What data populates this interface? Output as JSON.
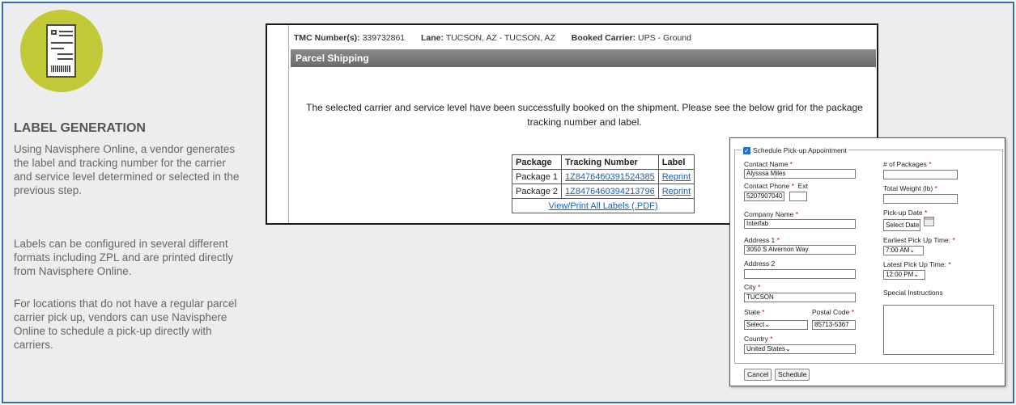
{
  "left_panel": {
    "title": "LABEL GENERATION",
    "para1": "Using Navisphere Online, a vendor generates the label and tracking number for the carrier and service level determined or selected in the previous step.",
    "para2": "Labels can be configured in several different formats including ZPL and are printed directly from Navisphere Online.",
    "para3": "For locations that do not have a regular parcel carrier pick up, vendors can use Navisphere Online to schedule a pick-up directly with carriers.",
    "icon": "label-document-icon",
    "icon_bg_color": "#c3c836"
  },
  "parcel_window": {
    "tmc_label": "TMC Number(s):",
    "tmc_value": "339732861",
    "lane_label": "Lane:",
    "lane_value": "TUCSON, AZ - TUCSON, AZ",
    "carrier_label": "Booked Carrier:",
    "carrier_value": "UPS - Ground",
    "section_title": "Parcel Shipping",
    "success_message": "The selected carrier and service level have been successfully booked on the shipment. Please see the below grid for the package tracking number and label.",
    "table": {
      "headers": [
        "Package",
        "Tracking Number",
        "Label"
      ],
      "rows": [
        {
          "package": "Package 1",
          "tracking": "1Z8476460391524385",
          "label": "Reprint"
        },
        {
          "package": "Package 2",
          "tracking": "1Z8476460394213796",
          "label": "Reprint"
        }
      ],
      "view_all": "View/Print All Labels (.PDF)"
    }
  },
  "pickup_form": {
    "legend": "Schedule Pick-up Appointment",
    "contact_name_label": "Contact Name",
    "contact_name_value": "Alysssa Miles",
    "contact_phone_label": "Contact Phone",
    "ext_label": "Ext",
    "contact_phone_value": "5207907040",
    "company_label": "Company Name",
    "company_value": "Interfab",
    "address1_label": "Address 1",
    "address1_value": "3050 S Alvernon Way",
    "address2_label": "Address 2",
    "city_label": "City",
    "city_value": "TUCSON",
    "state_label": "State",
    "state_value": "Select",
    "postal_label": "Postal Code",
    "postal_value": "85713-5367",
    "country_label": "Country",
    "country_value": "United States",
    "packages_label": "# of Packages",
    "weight_label": "Total Weight (lb)",
    "pickup_date_label": "Pick-up Date",
    "pickup_date_value": "Select Date",
    "earliest_label": "Earliest Pick Up Time:",
    "earliest_value": "7:00 AM",
    "latest_label": "Latest Pick Up Time:",
    "latest_value": "12:00 PM",
    "special_label": "Special Instructions",
    "required_mark": "*",
    "cancel_label": "Cancel",
    "schedule_label": "Schedule"
  }
}
